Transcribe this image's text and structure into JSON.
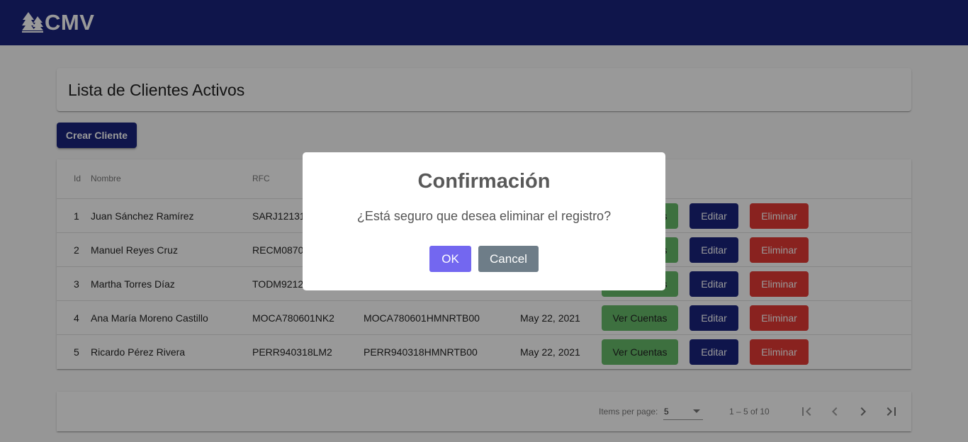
{
  "app": {
    "logo_text": "CMV",
    "logo_icon": "trees-icon"
  },
  "page": {
    "title": "Lista de Clientes Activos",
    "create_button": "Crear Cliente"
  },
  "table": {
    "headers": {
      "id": "Id",
      "nombre": "Nombre",
      "rfc": "RFC"
    },
    "rows": [
      {
        "id": "1",
        "nombre": "Juan Sánchez Ramírez",
        "rfc": "SARJ12131",
        "curp": "",
        "fecha": ""
      },
      {
        "id": "2",
        "nombre": "Manuel Reyes Cruz",
        "rfc": "RECM0870",
        "curp": "",
        "fecha": ""
      },
      {
        "id": "3",
        "nombre": "Martha Torres Díaz",
        "rfc": "TODM9212",
        "curp": "",
        "fecha": ""
      },
      {
        "id": "4",
        "nombre": "Ana María Moreno Castillo",
        "rfc": "MOCA780601NK2",
        "curp": "MOCA780601HMNRTB00",
        "fecha": "May 22, 2021"
      },
      {
        "id": "5",
        "nombre": "Ricardo Pérez Rivera",
        "rfc": "PERR940318LM2",
        "curp": "PERR940318HMNRTB00",
        "fecha": "May 22, 2021"
      }
    ],
    "actions": {
      "view": "Ver Cuentas",
      "edit": "Editar",
      "delete": "Eliminar"
    }
  },
  "paginator": {
    "items_label": "Items per page:",
    "page_size": "5",
    "range": "1 – 5 of 10"
  },
  "dialog": {
    "title": "Confirmación",
    "message": "¿Está seguro que desea eliminar el registro?",
    "ok": "OK",
    "cancel": "Cancel"
  },
  "colors": {
    "primary": "#1a237e",
    "success": "#66bb6a",
    "danger": "#e53935",
    "dialog_ok": "#7367f0",
    "dialog_cancel": "#6e7d88"
  }
}
